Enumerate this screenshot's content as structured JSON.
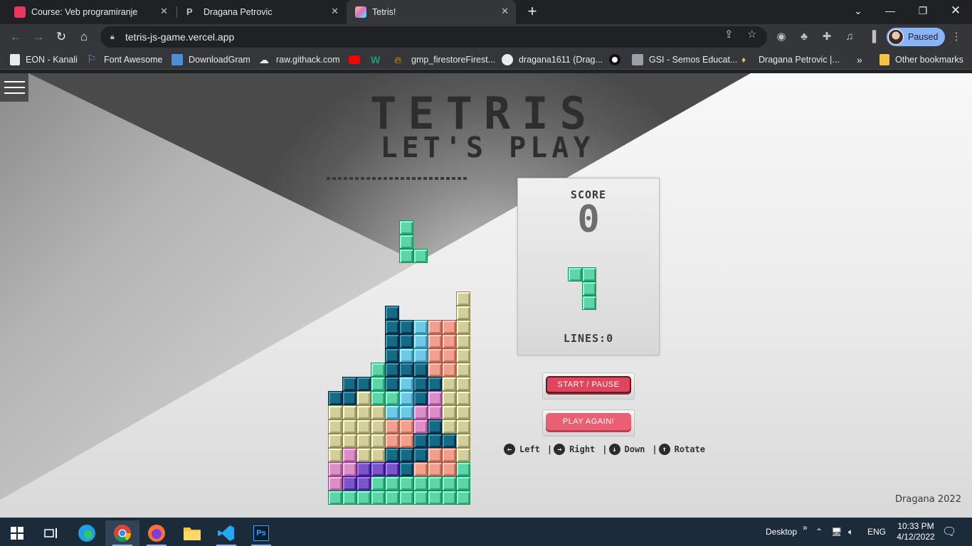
{
  "browser": {
    "tabs": [
      {
        "title": "Course: Veb programiranje",
        "favicon_color": "#e8385c",
        "active": false
      },
      {
        "title": "Dragana Petrovic",
        "favicon_color": "#5f6368",
        "active": false
      },
      {
        "title": "Tetris!",
        "favicon_color": "#d47cc8",
        "active": true
      }
    ],
    "url": "tetris-js-game.vercel.app",
    "profile_label": "Paused",
    "bookmarks": [
      {
        "label": "EON - Kanali",
        "icon": "eon-icon"
      },
      {
        "label": "Font Awesome",
        "icon": "flag-icon"
      },
      {
        "label": "DownloadGram",
        "icon": "instagram-icon"
      },
      {
        "label": "raw.githack.com",
        "icon": "githack-icon"
      },
      {
        "label": "",
        "icon": "youtube-icon"
      },
      {
        "label": "",
        "icon": "w-icon"
      },
      {
        "label": "gmp_firestoreFirest...",
        "icon": "firebase-icon"
      },
      {
        "label": "dragana1611 (Drag...",
        "icon": "github-icon"
      },
      {
        "label": "",
        "icon": "disk-icon"
      },
      {
        "label": "GSI - Semos Educat...",
        "icon": "gsi-icon"
      },
      {
        "label": "Dragana Petrovic |...",
        "icon": "dp-icon"
      }
    ],
    "bookmarks_more": "»",
    "other_bookmarks": "Other bookmarks"
  },
  "game": {
    "title": "TETRIS",
    "subtitle": "LET'S PLAY",
    "score_label": "SCORE",
    "score_value": "0",
    "lines_label": "LINES:0",
    "start_pause_label": "START / PAUSE",
    "play_again_label": "PLAY AGAIN!",
    "controls": [
      {
        "key": "arrow-left",
        "glyph": "←",
        "label": "Left"
      },
      {
        "key": "arrow-right",
        "glyph": "→",
        "label": "Right"
      },
      {
        "key": "arrow-down",
        "glyph": "↓",
        "label": "Down"
      },
      {
        "key": "arrow-up",
        "glyph": "↑",
        "label": "Rotate"
      }
    ],
    "control_separator": "|",
    "footer": "Dragana 2022",
    "colors": {
      "G": "#5fd4a6",
      "D": "#156a84",
      "B": "#6fc8e6",
      "S": "#f29f8e",
      "Y": "#d3cf9d",
      "P": "#db8ec8",
      "V": "#7a55c8"
    },
    "board_rows": [
      "..........",
      "..........",
      "..........",
      "..........",
      "..........",
      ".........Y",
      "....D....Y",
      "....DDBSSY",
      "....DDBSSY",
      "....DBBSSY",
      "...GDDDSSY",
      ".DDGDBDDYY",
      "DDYGGBDPYY",
      "YYYYBBPPYY",
      "YYYYSSPDYY",
      "YYYYSSDDDY",
      "YPYYDDDSSY",
      "PPVVVDSSSG",
      "PVVGGGGGGG",
      "GGGGGGGGGG"
    ],
    "falling_piece": {
      "color": "G",
      "cells": [
        [
          5,
          0
        ],
        [
          5,
          1
        ],
        [
          5,
          2
        ],
        [
          6,
          2
        ]
      ]
    },
    "next_piece": {
      "color": "G",
      "cells": [
        [
          0,
          0
        ],
        [
          1,
          0
        ],
        [
          1,
          1
        ],
        [
          1,
          2
        ]
      ]
    }
  },
  "taskbar": {
    "desktop_label": "Desktop",
    "chevron": "»",
    "language": "ENG",
    "time": "10:33 PM",
    "date": "4/12/2022"
  }
}
